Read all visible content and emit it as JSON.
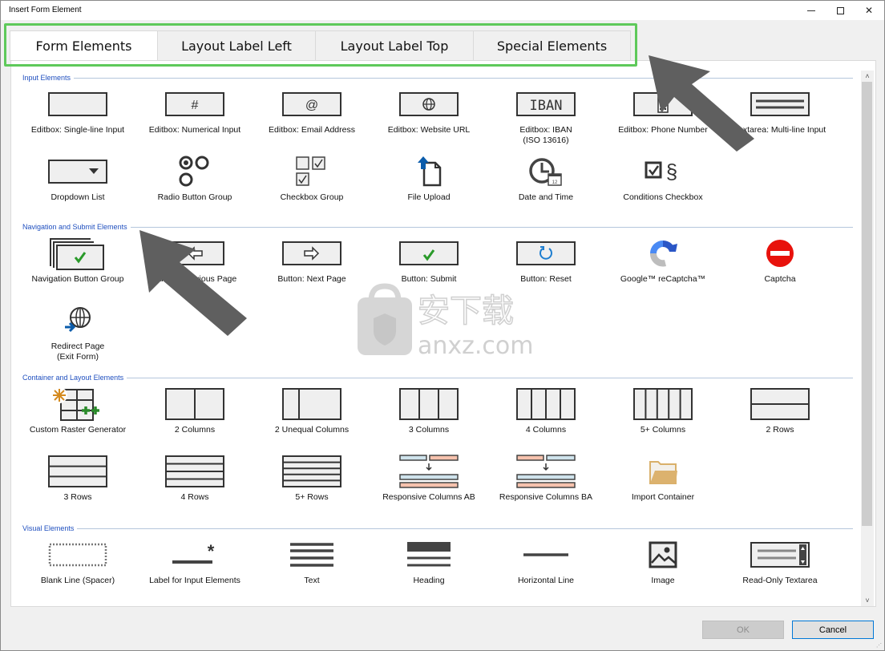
{
  "window": {
    "title": "Insert Form Element",
    "controls": {
      "minimize": "—",
      "maximize": "□",
      "close": "✕"
    }
  },
  "tabs": [
    {
      "label": "Form Elements",
      "active": true
    },
    {
      "label": "Layout Label Left",
      "active": false
    },
    {
      "label": "Layout Label Top",
      "active": false
    },
    {
      "label": "Special Elements",
      "active": false
    }
  ],
  "sections": [
    {
      "title": "Input Elements",
      "items": [
        {
          "label": "Editbox: Single-line Input",
          "icon": "editbox-icon"
        },
        {
          "label": "Editbox: Numerical Input",
          "icon": "hash-editbox-icon",
          "glyph": "#"
        },
        {
          "label": "Editbox: Email Address",
          "icon": "at-editbox-icon",
          "glyph": "@"
        },
        {
          "label": "Editbox: Website URL",
          "icon": "globe-editbox-icon",
          "glyph": "🌐"
        },
        {
          "label": "Editbox: IBAN\n(ISO 13616)",
          "icon": "iban-editbox-icon",
          "glyph": "IBAN"
        },
        {
          "label": "Editbox: Phone Number",
          "icon": "phone-editbox-icon"
        },
        {
          "label": "Textarea: Multi-line Input",
          "icon": "textarea-icon"
        },
        {
          "label": "Dropdown List",
          "icon": "dropdown-icon"
        },
        {
          "label": "Radio Button Group",
          "icon": "radio-group-icon"
        },
        {
          "label": "Checkbox Group",
          "icon": "checkbox-group-icon"
        },
        {
          "label": "File Upload",
          "icon": "file-upload-icon"
        },
        {
          "label": "Date and Time",
          "icon": "clock-calendar-icon",
          "glyph": "12"
        },
        {
          "label": "Conditions Checkbox",
          "icon": "conditions-checkbox-icon",
          "glyph": "§"
        }
      ]
    },
    {
      "title": "Navigation and Submit Elements",
      "items": [
        {
          "label": "Navigation Button Group",
          "icon": "nav-button-group-icon"
        },
        {
          "label": "Button: Previous Page",
          "icon": "previous-page-button-icon"
        },
        {
          "label": "Button: Next Page",
          "icon": "next-page-button-icon"
        },
        {
          "label": "Button: Submit",
          "icon": "submit-button-icon"
        },
        {
          "label": "Button: Reset",
          "icon": "reset-button-icon"
        },
        {
          "label": "Google™ reCaptcha™",
          "icon": "recaptcha-icon"
        },
        {
          "label": "Captcha",
          "icon": "captcha-stop-icon"
        },
        {
          "label": "Redirect Page\n(Exit Form)",
          "icon": "redirect-globe-icon"
        }
      ]
    },
    {
      "title": "Container and Layout Elements",
      "items": [
        {
          "label": "Custom Raster Generator",
          "icon": "raster-generator-icon"
        },
        {
          "label": "2 Columns",
          "icon": "two-columns-icon"
        },
        {
          "label": "2 Unequal Columns",
          "icon": "two-unequal-columns-icon"
        },
        {
          "label": "3 Columns",
          "icon": "three-columns-icon"
        },
        {
          "label": "4 Columns",
          "icon": "four-columns-icon"
        },
        {
          "label": "5+ Columns",
          "icon": "five-columns-icon"
        },
        {
          "label": "2 Rows",
          "icon": "two-rows-icon"
        },
        {
          "label": "3 Rows",
          "icon": "three-rows-icon"
        },
        {
          "label": "4 Rows",
          "icon": "four-rows-icon"
        },
        {
          "label": "5+ Rows",
          "icon": "five-rows-icon"
        },
        {
          "label": "Responsive Columns AB",
          "icon": "responsive-columns-ab-icon"
        },
        {
          "label": "Responsive Columns BA",
          "icon": "responsive-columns-ba-icon"
        },
        {
          "label": "Import Container",
          "icon": "folder-icon"
        }
      ]
    },
    {
      "title": "Visual Elements",
      "items": [
        {
          "label": "Blank Line (Spacer)",
          "icon": "spacer-icon"
        },
        {
          "label": "Label for Input Elements",
          "icon": "label-asterisk-icon",
          "glyph": "*"
        },
        {
          "label": "Text",
          "icon": "text-lines-icon"
        },
        {
          "label": "Heading",
          "icon": "heading-icon"
        },
        {
          "label": "Horizontal Line",
          "icon": "horizontal-line-icon"
        },
        {
          "label": "Image",
          "icon": "image-icon"
        },
        {
          "label": "Read-Only Textarea",
          "icon": "readonly-textarea-icon"
        }
      ]
    }
  ],
  "footer": {
    "ok_label": "OK",
    "ok_enabled": false,
    "cancel_label": "Cancel"
  },
  "scrollbar": {
    "up": "˄",
    "down": "˅"
  },
  "watermark": {
    "cn": "安下载",
    "site": "anxz.com",
    "badge": "安"
  },
  "colors": {
    "section_title": "#1f4fbf",
    "highlight": "#5ec95a",
    "check_green": "#2a9a2a",
    "captcha_red": "#e8120c",
    "accent_blue": "#0078d7"
  }
}
